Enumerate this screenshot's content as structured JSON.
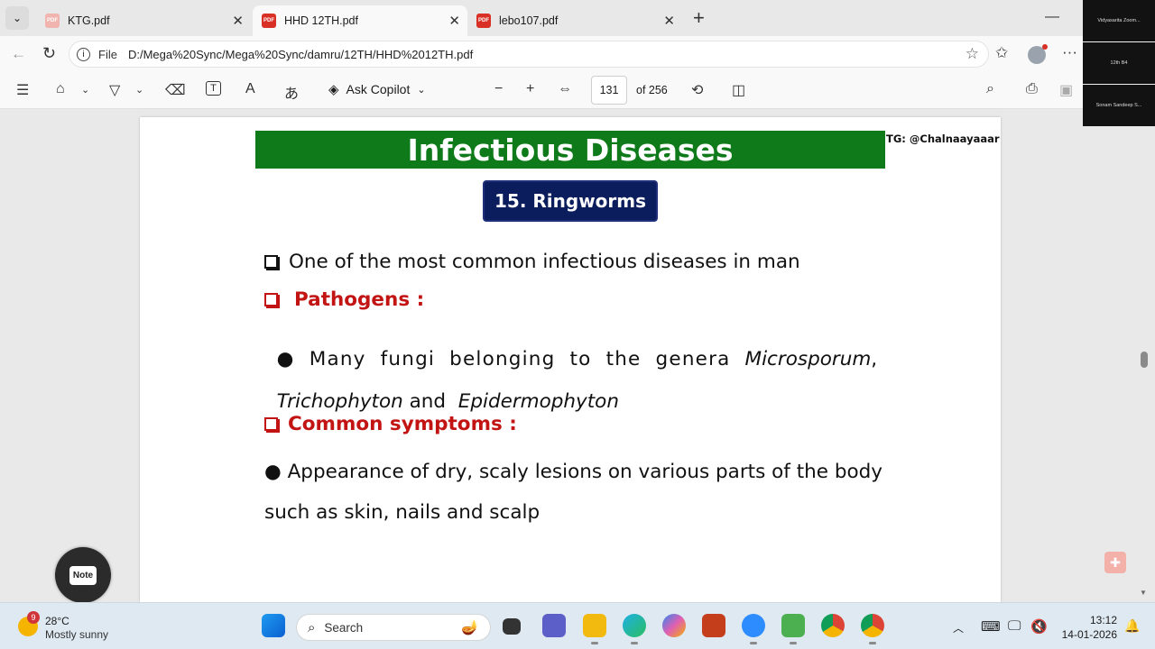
{
  "tabs": [
    {
      "label": "KTG.pdf"
    },
    {
      "label": "HHD 12TH.pdf"
    },
    {
      "label": "lebo107.pdf"
    }
  ],
  "address": {
    "scheme": "File",
    "url": "D:/Mega%20Sync/Mega%20Sync/damru/12TH/HHD%2012TH.pdf"
  },
  "pdf_toolbar": {
    "ask_copilot": "Ask Copilot",
    "page_current": "131",
    "page_total": "of 256"
  },
  "document": {
    "banner_title": "Infectious Diseases",
    "credit": "TG: @Chalnaayaaar",
    "section_title": "15. Ringworms",
    "bullet1": "One of the most common infectious diseases in man",
    "pathogens_heading": "Pathogens :",
    "pathogens_line1_a": "●  Many  fungi  belonging  to  the  genera ",
    "genus1": "Microsporum",
    "comma": ",",
    "genus2": "Trichophyton",
    "and": " and ",
    "genus3": "Epidermophyton",
    "symptoms_heading": "Common symptoms :",
    "symptoms_line1": "● Appearance of dry, scaly lesions on various parts of the body",
    "symptoms_line2": "such as skin, nails and scalp"
  },
  "note_widget": {
    "label": "Note"
  },
  "taskbar": {
    "weather_badge": "9",
    "temperature": "28°C",
    "weather": "Mostly sunny",
    "search_label": "Search",
    "time": "13:12",
    "date": "14-01-2026"
  },
  "zoom_thumbs": [
    {
      "label": "Vidyasarita Zoom..."
    },
    {
      "label": "12th B4"
    },
    {
      "label": "Sonam Sandeep S..."
    }
  ],
  "colors": {
    "banner": "#0e7a19",
    "pill": "#0c1d5e",
    "heading_red": "#c31414"
  }
}
